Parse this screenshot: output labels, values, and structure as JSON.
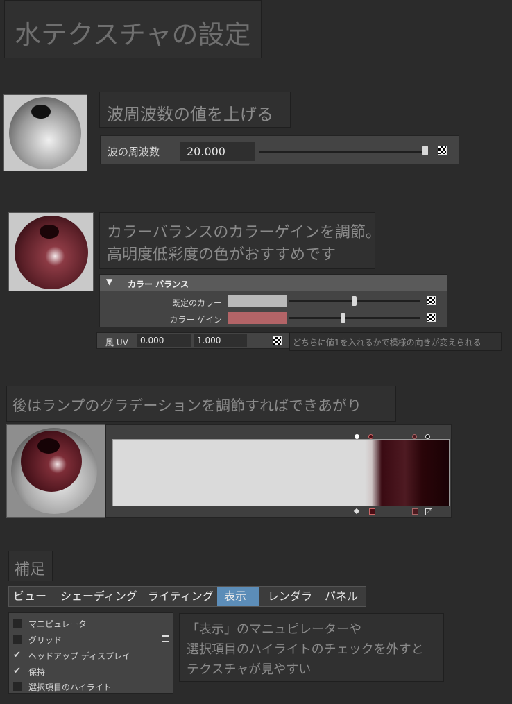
{
  "title": "水テクスチャの設定",
  "section1": {
    "note": "波周波数の値を上げる",
    "field_label": "波の周波数",
    "field_value": "20.000"
  },
  "section2": {
    "note_line1": "カラーバランスのカラーゲインを調節。",
    "note_line2": "高明度低彩度の色がおすすめです",
    "panel_title": "カラー バランス",
    "default_color_label": "既定のカラー",
    "color_gain_label": "カラー ゲイン",
    "colors": {
      "default_color": "#b9b9b9",
      "color_gain": "#b36467"
    },
    "uv_label": "風 UV",
    "uv_u": "0.000",
    "uv_v": "1.000",
    "uv_note": "どちらに値1を入れるかで模様の向きが変えられる"
  },
  "section3": {
    "note": "後はランプのグラデーションを調節すればできあがり"
  },
  "section4": {
    "note": "補足",
    "menu": [
      "ビュー",
      "シェーディング",
      "ライティング",
      "表示",
      "レンダラ",
      "パネル"
    ],
    "active_menu": "表示",
    "show_items": [
      {
        "label": "マニピュレータ",
        "checked": false
      },
      {
        "label": "グリッド",
        "checked": false
      },
      {
        "label": "ヘッドアップ ディスプレイ",
        "checked": true
      },
      {
        "label": "保持",
        "checked": true
      },
      {
        "label": "選択項目のハイライト",
        "checked": false
      }
    ],
    "tip_line1": "「表示」のマニュピレーターや",
    "tip_line2": "選択項目のハイライトのチェックを外すと",
    "tip_line3": "テクスチャが見やすい"
  }
}
